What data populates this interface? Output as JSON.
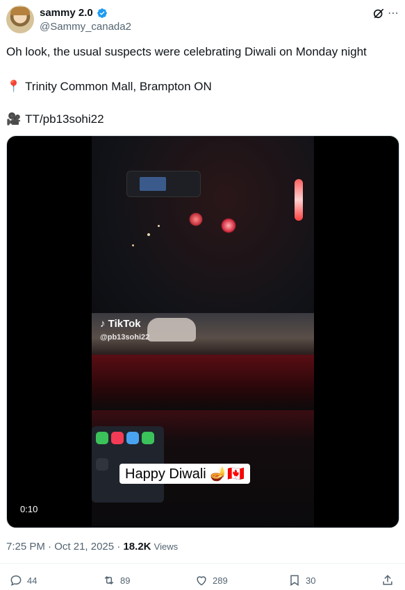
{
  "author": {
    "display_name": "sammy 2.0",
    "handle": "@Sammy_canada2",
    "verified": true
  },
  "icons": {
    "verified": "verified-badge-icon",
    "grok": "grok-icon",
    "more": "more-options-icon",
    "location": "round-pushpin-emoji",
    "camera": "movie-camera-emoji"
  },
  "tweet": {
    "line1": "Oh look, the usual suspects were celebrating Diwali on Monday night",
    "line2_emoji": "📍",
    "line2": "Trinity Common Mall, Brampton ON",
    "line3_emoji": "🎥",
    "line3": "TT/pb13sohi22"
  },
  "video": {
    "watermark": "TikTok",
    "watermark_user": "@pb13sohi22",
    "caption": "Happy Diwali 🪔🇨🇦",
    "duration": "0:10"
  },
  "meta": {
    "time": "7:25 PM",
    "separator": "·",
    "date": "Oct 21, 2025",
    "views_count": "18.2K",
    "views_label": "Views"
  },
  "actions": {
    "replies": "44",
    "reposts": "89",
    "likes": "289",
    "bookmarks": "30"
  },
  "colors": {
    "verified_blue": "#1d9bf0",
    "secondary_text": "#536471",
    "primary_text": "#0f1419"
  }
}
